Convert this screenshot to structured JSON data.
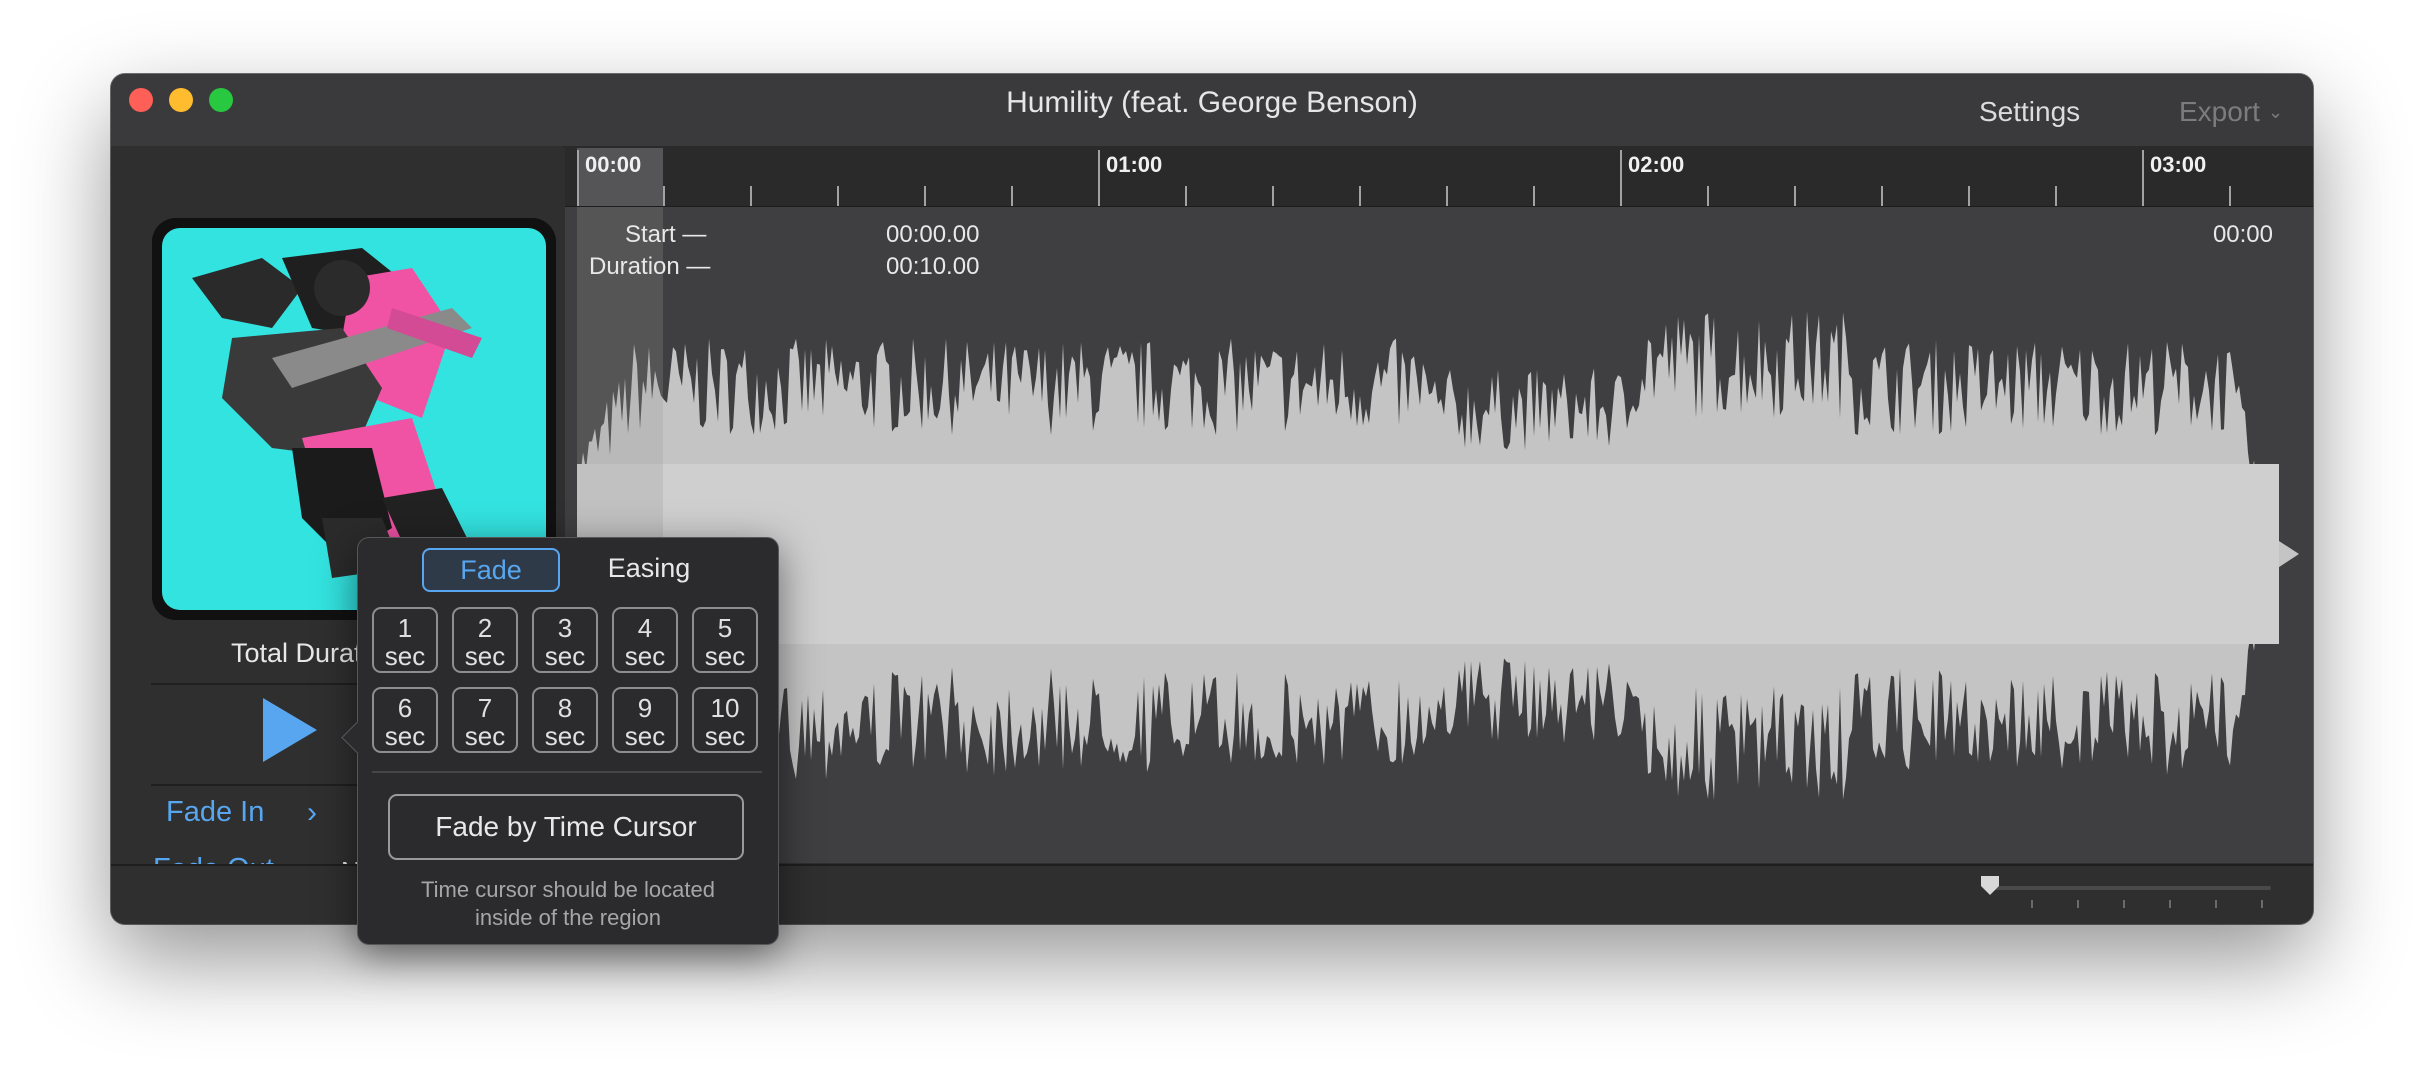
{
  "window": {
    "title": "Humility (feat. George Benson)",
    "settings_label": "Settings",
    "export_label": "Export"
  },
  "sidebar": {
    "album_art": "album-cover-image",
    "total_duration_label": "Total Durat",
    "fade_in_label": "Fade In",
    "fade_out_label": "Fade Out",
    "fade_out_value": "N"
  },
  "timeline": {
    "ruler_labels": [
      "00:00",
      "01:00",
      "02:00",
      "03:00"
    ],
    "selection": {
      "start_label": "Start —",
      "start_value": "00:00.00",
      "duration_label": "Duration —",
      "duration_value": "00:10.00"
    },
    "cursor_time": "00:00"
  },
  "popover": {
    "tab_fade": "Fade",
    "tab_easing": "Easing",
    "presets": [
      {
        "n": "1",
        "u": "sec"
      },
      {
        "n": "2",
        "u": "sec"
      },
      {
        "n": "3",
        "u": "sec"
      },
      {
        "n": "4",
        "u": "sec"
      },
      {
        "n": "5",
        "u": "sec"
      },
      {
        "n": "6",
        "u": "sec"
      },
      {
        "n": "7",
        "u": "sec"
      },
      {
        "n": "8",
        "u": "sec"
      },
      {
        "n": "9",
        "u": "sec"
      },
      {
        "n": "10",
        "u": "sec"
      }
    ],
    "cursor_button": "Fade by Time Cursor",
    "note_line1": "Time cursor should be located",
    "note_line2": "inside of the region"
  },
  "colors": {
    "accent": "#58a6ef",
    "window_bg": "#2f2f30",
    "waveform": "#c4c4c4"
  }
}
